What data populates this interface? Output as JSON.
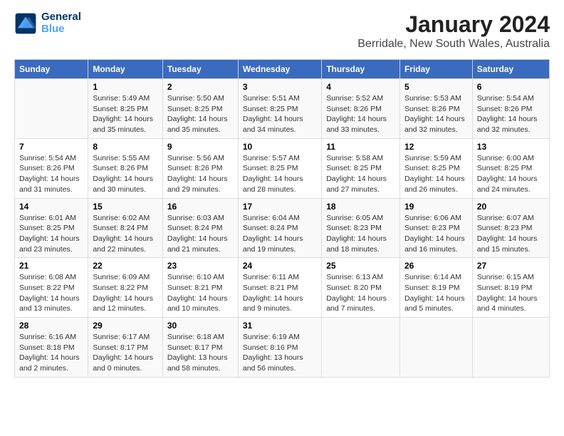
{
  "header": {
    "logo_line1": "General",
    "logo_line2": "Blue",
    "title": "January 2024",
    "subtitle": "Berridale, New South Wales, Australia"
  },
  "columns": [
    "Sunday",
    "Monday",
    "Tuesday",
    "Wednesday",
    "Thursday",
    "Friday",
    "Saturday"
  ],
  "weeks": [
    [
      {
        "day": "",
        "sunrise": "",
        "sunset": "",
        "daylight": ""
      },
      {
        "day": "1",
        "sunrise": "Sunrise: 5:49 AM",
        "sunset": "Sunset: 8:25 PM",
        "daylight": "Daylight: 14 hours and 35 minutes."
      },
      {
        "day": "2",
        "sunrise": "Sunrise: 5:50 AM",
        "sunset": "Sunset: 8:25 PM",
        "daylight": "Daylight: 14 hours and 35 minutes."
      },
      {
        "day": "3",
        "sunrise": "Sunrise: 5:51 AM",
        "sunset": "Sunset: 8:25 PM",
        "daylight": "Daylight: 14 hours and 34 minutes."
      },
      {
        "day": "4",
        "sunrise": "Sunrise: 5:52 AM",
        "sunset": "Sunset: 8:26 PM",
        "daylight": "Daylight: 14 hours and 33 minutes."
      },
      {
        "day": "5",
        "sunrise": "Sunrise: 5:53 AM",
        "sunset": "Sunset: 8:26 PM",
        "daylight": "Daylight: 14 hours and 32 minutes."
      },
      {
        "day": "6",
        "sunrise": "Sunrise: 5:54 AM",
        "sunset": "Sunset: 8:26 PM",
        "daylight": "Daylight: 14 hours and 32 minutes."
      }
    ],
    [
      {
        "day": "7",
        "sunrise": "Sunrise: 5:54 AM",
        "sunset": "Sunset: 8:26 PM",
        "daylight": "Daylight: 14 hours and 31 minutes."
      },
      {
        "day": "8",
        "sunrise": "Sunrise: 5:55 AM",
        "sunset": "Sunset: 8:26 PM",
        "daylight": "Daylight: 14 hours and 30 minutes."
      },
      {
        "day": "9",
        "sunrise": "Sunrise: 5:56 AM",
        "sunset": "Sunset: 8:26 PM",
        "daylight": "Daylight: 14 hours and 29 minutes."
      },
      {
        "day": "10",
        "sunrise": "Sunrise: 5:57 AM",
        "sunset": "Sunset: 8:25 PM",
        "daylight": "Daylight: 14 hours and 28 minutes."
      },
      {
        "day": "11",
        "sunrise": "Sunrise: 5:58 AM",
        "sunset": "Sunset: 8:25 PM",
        "daylight": "Daylight: 14 hours and 27 minutes."
      },
      {
        "day": "12",
        "sunrise": "Sunrise: 5:59 AM",
        "sunset": "Sunset: 8:25 PM",
        "daylight": "Daylight: 14 hours and 26 minutes."
      },
      {
        "day": "13",
        "sunrise": "Sunrise: 6:00 AM",
        "sunset": "Sunset: 8:25 PM",
        "daylight": "Daylight: 14 hours and 24 minutes."
      }
    ],
    [
      {
        "day": "14",
        "sunrise": "Sunrise: 6:01 AM",
        "sunset": "Sunset: 8:25 PM",
        "daylight": "Daylight: 14 hours and 23 minutes."
      },
      {
        "day": "15",
        "sunrise": "Sunrise: 6:02 AM",
        "sunset": "Sunset: 8:24 PM",
        "daylight": "Daylight: 14 hours and 22 minutes."
      },
      {
        "day": "16",
        "sunrise": "Sunrise: 6:03 AM",
        "sunset": "Sunset: 8:24 PM",
        "daylight": "Daylight: 14 hours and 21 minutes."
      },
      {
        "day": "17",
        "sunrise": "Sunrise: 6:04 AM",
        "sunset": "Sunset: 8:24 PM",
        "daylight": "Daylight: 14 hours and 19 minutes."
      },
      {
        "day": "18",
        "sunrise": "Sunrise: 6:05 AM",
        "sunset": "Sunset: 8:23 PM",
        "daylight": "Daylight: 14 hours and 18 minutes."
      },
      {
        "day": "19",
        "sunrise": "Sunrise: 6:06 AM",
        "sunset": "Sunset: 8:23 PM",
        "daylight": "Daylight: 14 hours and 16 minutes."
      },
      {
        "day": "20",
        "sunrise": "Sunrise: 6:07 AM",
        "sunset": "Sunset: 8:23 PM",
        "daylight": "Daylight: 14 hours and 15 minutes."
      }
    ],
    [
      {
        "day": "21",
        "sunrise": "Sunrise: 6:08 AM",
        "sunset": "Sunset: 8:22 PM",
        "daylight": "Daylight: 14 hours and 13 minutes."
      },
      {
        "day": "22",
        "sunrise": "Sunrise: 6:09 AM",
        "sunset": "Sunset: 8:22 PM",
        "daylight": "Daylight: 14 hours and 12 minutes."
      },
      {
        "day": "23",
        "sunrise": "Sunrise: 6:10 AM",
        "sunset": "Sunset: 8:21 PM",
        "daylight": "Daylight: 14 hours and 10 minutes."
      },
      {
        "day": "24",
        "sunrise": "Sunrise: 6:11 AM",
        "sunset": "Sunset: 8:21 PM",
        "daylight": "Daylight: 14 hours and 9 minutes."
      },
      {
        "day": "25",
        "sunrise": "Sunrise: 6:13 AM",
        "sunset": "Sunset: 8:20 PM",
        "daylight": "Daylight: 14 hours and 7 minutes."
      },
      {
        "day": "26",
        "sunrise": "Sunrise: 6:14 AM",
        "sunset": "Sunset: 8:19 PM",
        "daylight": "Daylight: 14 hours and 5 minutes."
      },
      {
        "day": "27",
        "sunrise": "Sunrise: 6:15 AM",
        "sunset": "Sunset: 8:19 PM",
        "daylight": "Daylight: 14 hours and 4 minutes."
      }
    ],
    [
      {
        "day": "28",
        "sunrise": "Sunrise: 6:16 AM",
        "sunset": "Sunset: 8:18 PM",
        "daylight": "Daylight: 14 hours and 2 minutes."
      },
      {
        "day": "29",
        "sunrise": "Sunrise: 6:17 AM",
        "sunset": "Sunset: 8:17 PM",
        "daylight": "Daylight: 14 hours and 0 minutes."
      },
      {
        "day": "30",
        "sunrise": "Sunrise: 6:18 AM",
        "sunset": "Sunset: 8:17 PM",
        "daylight": "Daylight: 13 hours and 58 minutes."
      },
      {
        "day": "31",
        "sunrise": "Sunrise: 6:19 AM",
        "sunset": "Sunset: 8:16 PM",
        "daylight": "Daylight: 13 hours and 56 minutes."
      },
      {
        "day": "",
        "sunrise": "",
        "sunset": "",
        "daylight": ""
      },
      {
        "day": "",
        "sunrise": "",
        "sunset": "",
        "daylight": ""
      },
      {
        "day": "",
        "sunrise": "",
        "sunset": "",
        "daylight": ""
      }
    ]
  ]
}
